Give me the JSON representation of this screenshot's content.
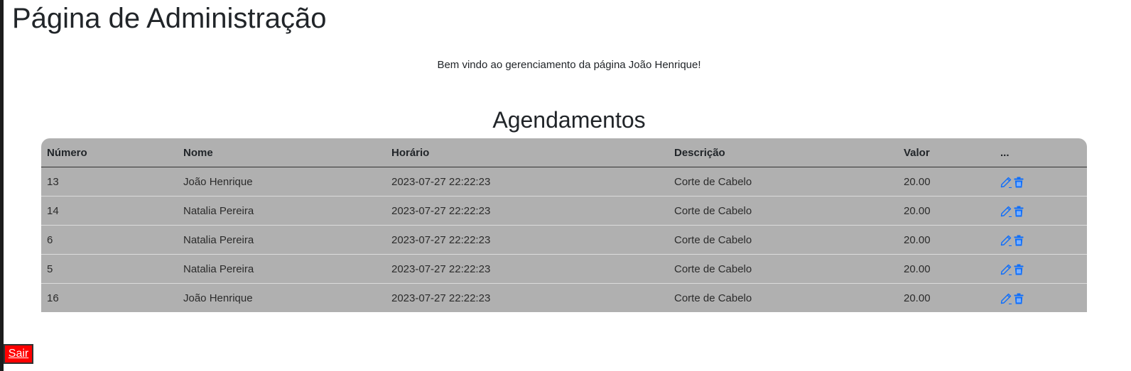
{
  "header": {
    "title": "Página de Administração",
    "welcome": "Bem vindo ao gerenciamento da página João Henrique!"
  },
  "appointments": {
    "title": "Agendamentos",
    "columns": [
      "Número",
      "Nome",
      "Horário",
      "Descrição",
      "Valor",
      "..."
    ],
    "rows": [
      {
        "numero": "13",
        "nome": "João Henrique",
        "horario": "2023-07-27 22:22:23",
        "descricao": "Corte de Cabelo",
        "valor": "20.00"
      },
      {
        "numero": "14",
        "nome": "Natalia Pereira",
        "horario": "2023-07-27 22:22:23",
        "descricao": "Corte de Cabelo",
        "valor": "20.00"
      },
      {
        "numero": "6",
        "nome": "Natalia Pereira",
        "horario": "2023-07-27 22:22:23",
        "descricao": "Corte de Cabelo",
        "valor": "20.00"
      },
      {
        "numero": "5",
        "nome": "Natalia Pereira",
        "horario": "2023-07-27 22:22:23",
        "descricao": "Corte de Cabelo",
        "valor": "20.00"
      },
      {
        "numero": "16",
        "nome": "João Henrique",
        "horario": "2023-07-27 22:22:23",
        "descricao": "Corte de Cabelo",
        "valor": "20.00"
      }
    ],
    "row_actions": [
      "pencil-icon",
      "trash-icon"
    ]
  },
  "footer": {
    "logout_label": "Sair"
  },
  "colors": {
    "table_background": "#b0b0b0",
    "action_icon": "#0d6efd",
    "logout_background": "#ff0000",
    "logout_text": "#ffffff"
  }
}
